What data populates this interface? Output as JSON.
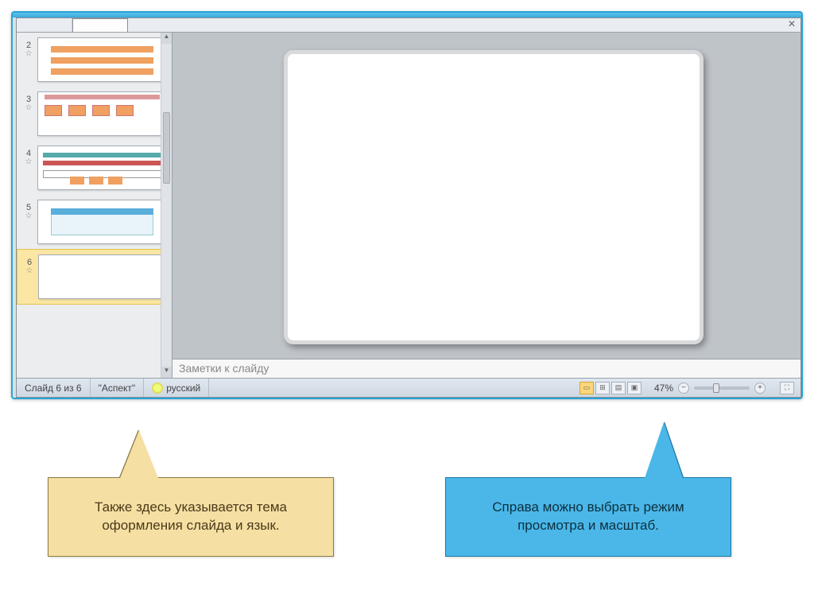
{
  "tabs": {
    "outline_label": " ",
    "slides_label": " ",
    "close_glyph": "✕"
  },
  "thumbnails": [
    {
      "n": "2",
      "star": "☆"
    },
    {
      "n": "3",
      "star": "☆"
    },
    {
      "n": "4",
      "star": "☆"
    },
    {
      "n": "5",
      "star": "☆"
    },
    {
      "n": "6",
      "star": "☆"
    }
  ],
  "selected_slide_index": 4,
  "notes_placeholder": "Заметки к слайду",
  "status": {
    "slide_counter": "Слайд 6 из 6",
    "theme": "\"Аспект\"",
    "language": "русский",
    "view_icons": {
      "normal": "▭",
      "sorter": "⊞",
      "reading": "▤",
      "slideshow": "▣"
    },
    "zoom_pct": "47%",
    "zoom_minus": "−",
    "zoom_plus": "+",
    "fit_glyph": "⛶"
  },
  "callouts": {
    "left_text": "Также  здесь указывается тема оформления слайда и язык.",
    "right_text": "Справа можно выбрать режим просмотра и масштаб."
  }
}
